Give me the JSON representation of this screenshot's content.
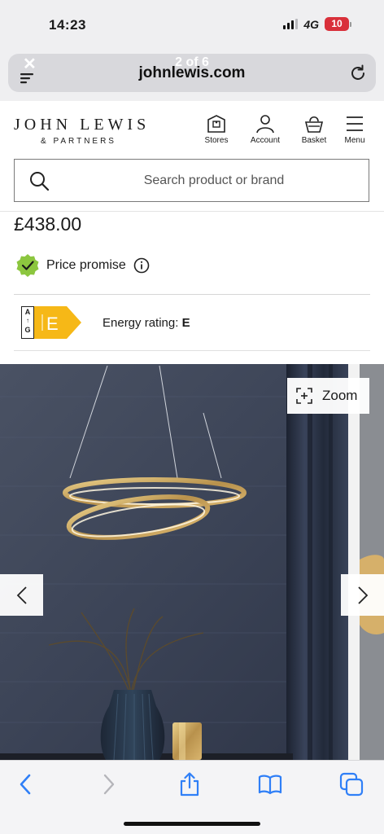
{
  "status_bar": {
    "time": "14:23",
    "network": "4G",
    "battery": "10"
  },
  "safari": {
    "domain": "johnlewis.com",
    "overlay_text": "2 of 6"
  },
  "header": {
    "brand": "JOHN LEWIS",
    "brand_sub": "& PARTNERS",
    "nav": [
      {
        "label": "Stores",
        "icon": "store-icon"
      },
      {
        "label": "Account",
        "icon": "account-icon"
      },
      {
        "label": "Basket",
        "icon": "basket-icon"
      },
      {
        "label": "Menu",
        "icon": "menu-icon"
      }
    ]
  },
  "search": {
    "placeholder": "Search product or brand"
  },
  "product": {
    "price": "£438.00",
    "price_promise": "Price promise",
    "energy_scale_top": "A",
    "energy_scale_bottom": "G",
    "energy_class": "E",
    "energy_label": "Energy rating: ",
    "energy_value": "E"
  },
  "gallery": {
    "zoom_label": "Zoom",
    "image": "gold-ring-pendant-light-photo"
  },
  "toolbar": [
    "back-icon",
    "forward-icon",
    "share-icon",
    "bookmarks-icon",
    "tabs-icon"
  ],
  "colors": {
    "accent_blue": "#2f7ff7",
    "energy_yellow": "#f6b817",
    "promise_green": "#8cc63f",
    "battery_red": "#d9303a"
  }
}
